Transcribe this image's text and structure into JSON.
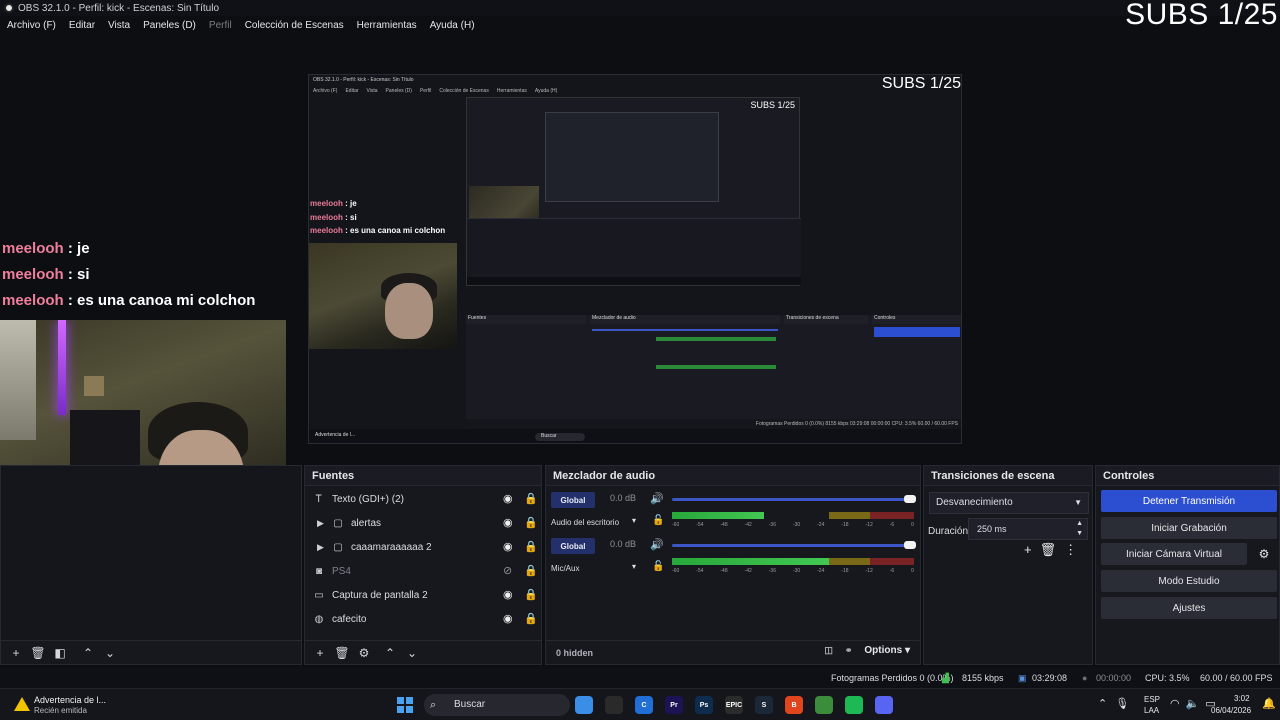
{
  "window": {
    "title": "OBS 32.1.0 - Perfil: kick - Escenas: Sin Título"
  },
  "menu": [
    {
      "label": "Archivo (F)",
      "disabled": false
    },
    {
      "label": "Editar",
      "disabled": false
    },
    {
      "label": "Vista",
      "disabled": false
    },
    {
      "label": "Paneles (D)",
      "disabled": false
    },
    {
      "label": "Perfil",
      "disabled": true
    },
    {
      "label": "Colección de Escenas",
      "disabled": false
    },
    {
      "label": "Herramientas",
      "disabled": false
    },
    {
      "label": "Ayuda (H)",
      "disabled": false
    }
  ],
  "overlay": {
    "subs": "SUBS 1/25"
  },
  "chat": [
    {
      "name": "meelooh",
      "sep": " : ",
      "text": "je"
    },
    {
      "name": "meelooh",
      "sep": " : ",
      "text": "si"
    },
    {
      "name": "meelooh",
      "sep": " : ",
      "text": "es una canoa mi colchon"
    }
  ],
  "inner": {
    "title": "OBS 32.1.0 - Perfil: kick - Escenas: Sin Título",
    "menu": [
      "Archivo (F)",
      "Editar",
      "Vista",
      "Paneles (D)",
      "Perfil",
      "Colección de Escenas",
      "Herramientas",
      "Ayuda (H)"
    ],
    "subs": "SUBS 1/25",
    "docks": [
      "Fuentes",
      "Mezclador de audio",
      "Transiciones de escena",
      "Controles"
    ],
    "status": "Fotogramas Perdidos 0 (0.0%)   8155 kbps   03:29:08   00:00:00   CPU: 3.5%   60.00 / 60.00 FPS",
    "taskbar_warn": "Advertencia de l...",
    "search": "Buscar"
  },
  "docks": {
    "sources": {
      "title": "Fuentes",
      "items": [
        {
          "icon": "text-icon",
          "glyph": "ꞁ",
          "label": "Texto (GDI+) (2)",
          "expandable": false,
          "dim": false
        },
        {
          "icon": "folder-icon",
          "glyph": "▭",
          "label": "alertas",
          "expandable": true,
          "dim": false
        },
        {
          "icon": "folder-icon",
          "glyph": "▭",
          "label": "caaamaraaaaaa 2",
          "expandable": true,
          "dim": false
        },
        {
          "icon": "camera-icon",
          "glyph": "◙",
          "label": "PS4",
          "expandable": false,
          "dim": true
        },
        {
          "icon": "monitor-icon",
          "glyph": "▭",
          "label": "Captura de pantalla 2",
          "expandable": false,
          "dim": false
        },
        {
          "icon": "browser-icon",
          "glyph": "◉",
          "label": "cafecito",
          "expandable": false,
          "dim": false
        }
      ]
    },
    "mixer": {
      "title": "Mezclador de audio",
      "channels": [
        {
          "badge": "Global",
          "db": "0.0 dB",
          "name": "Audio del escritorio",
          "level": 0.38
        },
        {
          "badge": "Global",
          "db": "0.0 dB",
          "name": "Mic/Aux",
          "level": 0.65
        }
      ],
      "scale": [
        "-60",
        "-54",
        "-48",
        "-42",
        "-36",
        "-30",
        "-24",
        "-18",
        "-12",
        "-6",
        "0"
      ],
      "hidden": "0 hidden",
      "options": "Options"
    },
    "transitions": {
      "title": "Transiciones de escena",
      "selected": "Desvanecimiento",
      "duration_label": "Duración",
      "duration_value": "250 ms"
    },
    "controls": {
      "title": "Controles",
      "buttons": [
        "Detener Transmisión",
        "Iniciar Grabación",
        "Iniciar Cámara Virtual",
        "Modo Estudio",
        "Ajustes"
      ]
    }
  },
  "status": {
    "dropped": "Fotogramas Perdidos 0 (0.0%)",
    "bitrate": "8155 kbps",
    "stream_time": "03:29:08",
    "record_time": "00:00:00",
    "cpu": "CPU: 3.5%",
    "fps": "60.00 / 60.00 FPS"
  },
  "taskbar": {
    "warn_title": "Advertencia de l...",
    "warn_sub": "Recién emitida",
    "search": "Buscar",
    "apps": [
      {
        "name": "file-explorer-icon",
        "text": "",
        "color": "#3a8ee6"
      },
      {
        "name": "obs-icon",
        "text": "",
        "color": "#2a2a2a"
      },
      {
        "name": "browser-c-icon",
        "text": "C",
        "color": "#1f6fd6"
      },
      {
        "name": "premiere-icon",
        "text": "Pr",
        "color": "#1b1354"
      },
      {
        "name": "photoshop-icon",
        "text": "Ps",
        "color": "#0d2c4e"
      },
      {
        "name": "epic-games-icon",
        "text": "EPIC",
        "color": "#2b2b2b"
      },
      {
        "name": "steam-icon",
        "text": "S",
        "color": "#1b2838"
      },
      {
        "name": "brave-icon",
        "text": "B",
        "color": "#e0451e"
      },
      {
        "name": "chrome-icon",
        "text": "",
        "color": "#3b8c3b"
      },
      {
        "name": "spotify-icon",
        "text": "",
        "color": "#1db954"
      },
      {
        "name": "discord-icon",
        "text": "",
        "color": "#5865f2"
      }
    ],
    "lang1": "ESP",
    "lang2": "LAA",
    "time": "3:02",
    "date": "06/04/2026"
  },
  "colors": {
    "accent": "#2c4fd1",
    "chat_name": "#f07f9c",
    "meter_green": "#43c853"
  }
}
